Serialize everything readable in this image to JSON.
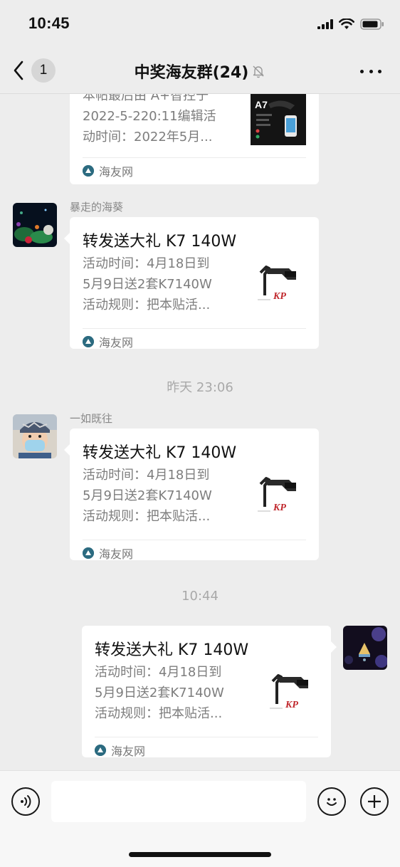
{
  "status": {
    "time": "10:45"
  },
  "nav": {
    "back_count": "1",
    "title": "中奖海友群(24)"
  },
  "timestamps": [
    "昨天 23:06",
    "10:44"
  ],
  "messages": [
    {
      "sender": "",
      "desc_lines": [
        "本帖最后由 A+智控于",
        "2022-5-220:11编辑活",
        "动时间：2022年5月..."
      ],
      "source": "海友网",
      "thumb_text": "A7"
    },
    {
      "sender": "暴走的海葵",
      "title": "转发送大礼 K7 140W",
      "desc_lines": [
        "活动时间：4月18日到",
        "5月9日送2套K7140W",
        "活动规则：把本贴活..."
      ],
      "source": "海友网",
      "thumb_brand": "KP"
    },
    {
      "sender": "一如既往",
      "title": "转发送大礼 K7 140W",
      "desc_lines": [
        "活动时间：4月18日到",
        "5月9日送2套K7140W",
        "活动规则：把本贴活..."
      ],
      "source": "海友网",
      "thumb_brand": "KP"
    },
    {
      "sender": "",
      "title": "转发送大礼 K7 140W",
      "desc_lines": [
        "活动时间：4月18日到",
        "5月9日送2套K7140W",
        "活动规则：把本贴活..."
      ],
      "source": "海友网",
      "thumb_brand": "KP"
    }
  ],
  "icons": {
    "back": "chevron-left-icon",
    "mute": "bell-slash-icon",
    "more": "more-dots-icon",
    "voice": "voice-icon",
    "emoji": "emoji-icon",
    "add": "plus-icon",
    "source_logo": "haiyou-logo-icon"
  },
  "colors": {
    "background": "#ededed",
    "bubble": "#ffffff",
    "secondary_text": "#7d7d7d",
    "brand_red": "#c0282d"
  }
}
